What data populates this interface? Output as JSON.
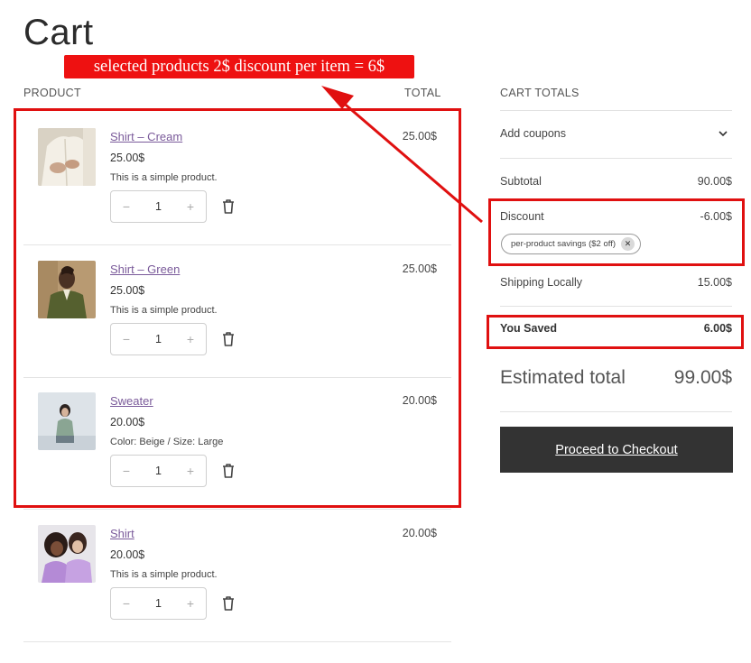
{
  "page": {
    "title": "Cart"
  },
  "annotation": {
    "callout": "selected products 2$ discount per item = 6$",
    "color": "#ee1111"
  },
  "cart_table": {
    "headers": {
      "product": "PRODUCT",
      "total": "TOTAL"
    },
    "items": [
      {
        "name": "Shirt – Cream",
        "price": "25.00$",
        "description": "This is a simple product.",
        "quantity": "1",
        "line_total": "25.00$",
        "thumb_icon": "shirt-cream-photo"
      },
      {
        "name": "Shirt – Green",
        "price": "25.00$",
        "description": "This is a simple product.",
        "quantity": "1",
        "line_total": "25.00$",
        "thumb_icon": "shirt-green-photo"
      },
      {
        "name": "Sweater",
        "price": "20.00$",
        "description": "Color: Beige / Size: Large",
        "quantity": "1",
        "line_total": "20.00$",
        "thumb_icon": "sweater-photo"
      },
      {
        "name": "Shirt",
        "price": "20.00$",
        "description": "This is a simple product.",
        "quantity": "1",
        "line_total": "20.00$",
        "thumb_icon": "shirt-photo"
      }
    ],
    "qty_minus": "−",
    "qty_plus": "+"
  },
  "totals": {
    "heading": "CART TOTALS",
    "coupons_label": "Add coupons",
    "subtotal_label": "Subtotal",
    "subtotal_value": "90.00$",
    "discount_label": "Discount",
    "discount_value": "-6.00$",
    "coupon_chip": "per-product savings ($2 off)",
    "chip_remove": "✕",
    "shipping_label": "Shipping Locally",
    "shipping_value": "15.00$",
    "saved_label": "You Saved",
    "saved_value": "6.00$",
    "estimated_label": "Estimated total",
    "estimated_value": "99.00$",
    "checkout_label": "Proceed to Checkout"
  },
  "colors": {
    "accent_link": "#7a5a9a",
    "button_bg": "#333333",
    "highlight": "#e01010"
  }
}
